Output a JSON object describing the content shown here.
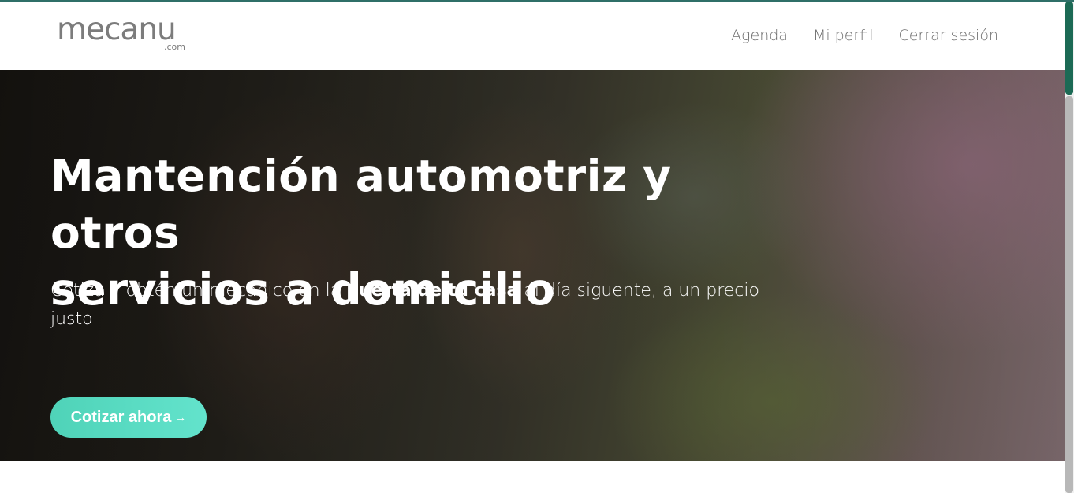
{
  "brand": {
    "logo_main": "mecanu",
    "logo_sub": ".com"
  },
  "nav": {
    "items": [
      {
        "label": "Agenda"
      },
      {
        "label": "Mi perfil"
      },
      {
        "label": "Cerrar sesión"
      }
    ]
  },
  "hero": {
    "title_line1": "Mantención automotriz y otros",
    "title_line2": "servicios a domicilio",
    "subtitle_before": "Cotiza y obtén un mecánico en la ",
    "subtitle_bold": "puerta de tu casa",
    "subtitle_after": " al día siguente, a un precio justo",
    "cta_label": "Cotizar ahora",
    "cta_icon": "arrow-right-icon"
  },
  "colors": {
    "brand_accent": "#4fd3b8",
    "logo_gray": "#7c7c7c",
    "scroll_thumb": "#1c6a55"
  }
}
